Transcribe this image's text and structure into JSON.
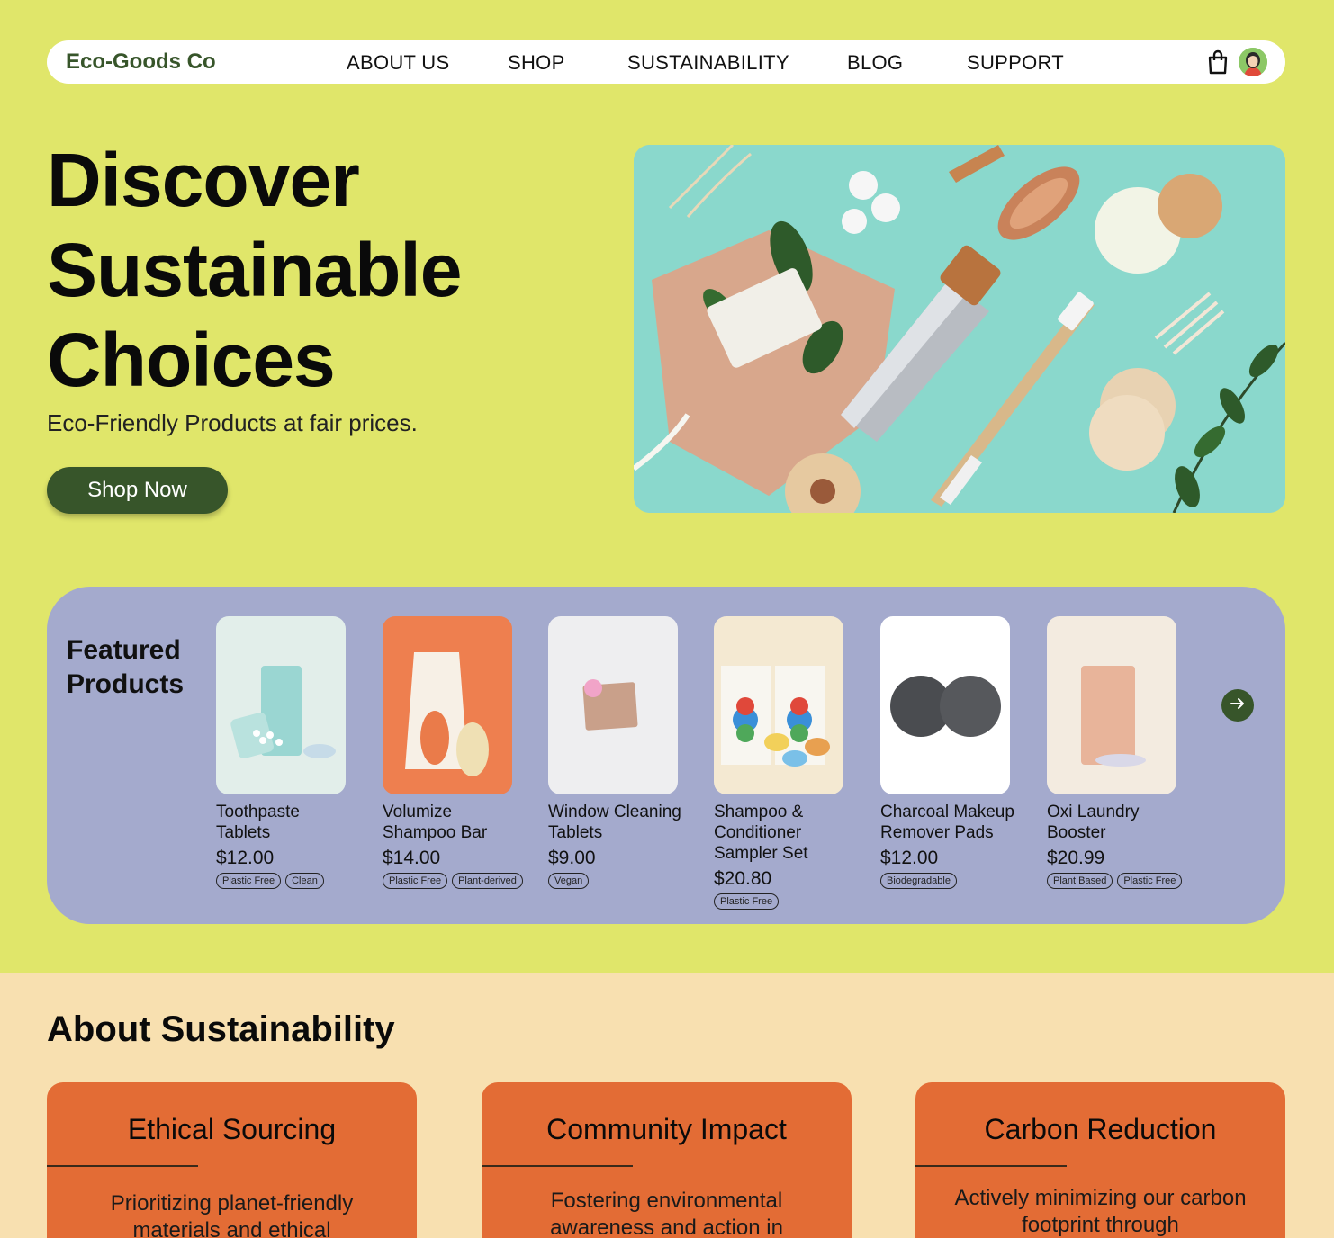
{
  "nav": {
    "brand": "Eco-Goods Co",
    "links": [
      "ABOUT US",
      "SHOP",
      "SUSTAINABILITY",
      "BLOG",
      "SUPPORT"
    ],
    "icons": [
      "shopping-bag-icon",
      "user-avatar"
    ]
  },
  "hero": {
    "title_lines": [
      "Discover",
      "Sustainable",
      "Choices"
    ],
    "subtitle": "Eco-Friendly Products at fair prices.",
    "cta": "Shop Now"
  },
  "featured": {
    "title_lines": [
      "Featured",
      "Products"
    ],
    "products": [
      {
        "name": "Toothpaste Tablets",
        "price": "$12.00",
        "tags": [
          "Plastic Free",
          "Clean"
        ]
      },
      {
        "name": "Volumize Shampoo Bar",
        "price": "$14.00",
        "tags": [
          "Plastic Free",
          "Plant-derived"
        ]
      },
      {
        "name": "Window Cleaning Tablets",
        "price": "$9.00",
        "tags": [
          "Vegan"
        ]
      },
      {
        "name": "Shampoo & Conditioner Sampler Set",
        "price": "$20.80",
        "tags": [
          "Plastic Free"
        ]
      },
      {
        "name": "Charcoal Makeup Remover Pads",
        "price": "$12.00",
        "tags": [
          "Biodegradable"
        ]
      },
      {
        "name": "Oxi Laundry Booster",
        "price": "$20.99",
        "tags": [
          "Plant Based",
          "Plastic Free"
        ]
      }
    ]
  },
  "about": {
    "title": "About Sustainability",
    "cards": [
      {
        "title": "Ethical Sourcing",
        "text": "Prioritizing planet-friendly materials and ethical"
      },
      {
        "title": "Community Impact",
        "text": "Fostering environmental awareness and action in"
      },
      {
        "title": "Carbon Reduction",
        "text": "Actively minimizing our carbon footprint through"
      }
    ]
  },
  "colors": {
    "page_bg": "#e0e66a",
    "brand_green": "#37552a",
    "featured_bg": "#a4aacd",
    "about_bg": "#f8e0b0",
    "card_orange": "#e36c35"
  }
}
